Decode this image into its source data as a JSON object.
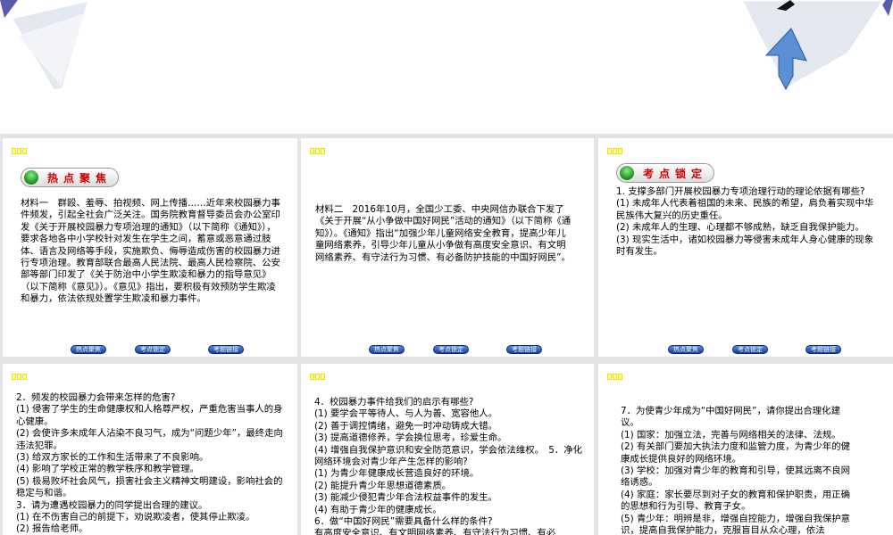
{
  "tag": "□□□",
  "nav_buttons": [
    "热点聚焦",
    "考点锁定",
    "考题链接"
  ],
  "slides": [
    {
      "heading": "热点聚焦",
      "text": "材料一　群殴、羞辱、拍视频、网上传播……近年来校园暴力事件频发，引起全社会广泛关注。国务院教育督导委员会办公室印发《关于开展校园暴力专项治理的通知》（以下简称《通知》），要求各地各中小学校针对发生在学生之间，蓄意或恶意通过肢体、语言及网络等手段，实施欺负、侮辱造成伤害的校园暴力进行专项治理。教育部联合最高人民法院、最高人民检察院、公安部等部门印发了《关于防治中小学生欺凌和暴力的指导意见》（以下简称《意见》）。《意见》指出，要积极有效预防学生欺凌和暴力，依法依规处置学生欺凌和暴力事件。"
    },
    {
      "text": "材料二　2016年10月，全国少工委、中央网信办联合下发了《关于开展“从小争做中国好网民”活动的通知》（以下简称《通知》）。《通知》指出“加强少年儿童网络安全教育，提高少年儿童网络素养，引导少年儿童从小争做有高度安全意识、有文明网络素养、有守法行为习惯、有必备防护技能的中国好网民”。"
    },
    {
      "heading": "考点锁定",
      "text": "1. 支撑多部门开展校园暴力专项治理行动的理论依据有哪些?\n(1) 未成年人代表着祖国的未来、民族的希望，肩负着实现中华民族伟大复兴的历史重任。\n(2) 未成年人的生理、心理都不够成熟，缺乏自我保护能力。\n(3) 现实生活中，诸如校园暴力等侵害未成年人身心健康的现象时有发生。"
    },
    {
      "text": "2．频发的校园暴力会带来怎样的危害?\n(1) 侵害了学生的生命健康权和人格尊严权，严重危害当事人的身心健康。\n(2) 会使许多未成年人沾染不良习气，成为“问题少年”，最终走向违法犯罪。\n(3) 给双方家长的工作和生活带来了不良影响。\n(4) 影响了学校正常的教学秩序和教学管理。\n(5) 极易败坏社会风气，损害社会主义精神文明建设，影响社会的稳定与和谐。\n3．请为遭遇校园暴力的同学提出合理的建议。\n(1) 在不伤害自己的前提下，劝说欺凌者，使其停止欺凌。\n(2) 报告给老师。"
    },
    {
      "text": "4．校园暴力事件给我们的启示有哪些?\n(1) 要学会平等待人、与人为善、宽容他人。\n(2) 善于调控情绪，避免一时冲动铸成大错。\n(3) 提高道德修养，学会换位思考，珍爱生命。\n(4) 增强自我保护意识和安全防范意识，学会依法维权。　5．净化网络环境会对青少年产生怎样的影响?\n(1) 为青少年健康成长营造良好的环境。\n(2) 能提升青少年思想道德素质。\n(3) 能减少侵犯青少年合法权益事件的发生。\n(4) 有助于青少年的健康成长。\n6．做“中国好网民”需要具备什么样的条件?\n有高度安全意识、有文明网络素养、有守法行为习惯、有必"
    },
    {
      "text": "7．为使青少年成为“中国好网民”，请你提出合理化建议。\n(1) 国家：加强立法，完善与网络相关的法律、法规。\n(2) 有关部门要加大执法力度和监管力度，为青少年的健康成长提供良好的网络环境。\n(3) 学校：加强对青少年的教育和引导，使其远离不良网络诱惑。\n(4) 家庭：家长要尽到对子女的教育和保护职责，用正确的思想和行为引导、教育子女。\n(5) 青少年：明辨是非，增强自控能力，增强自我保护意识，提高自我保护能力，克服盲目从众心理，依法"
    }
  ]
}
